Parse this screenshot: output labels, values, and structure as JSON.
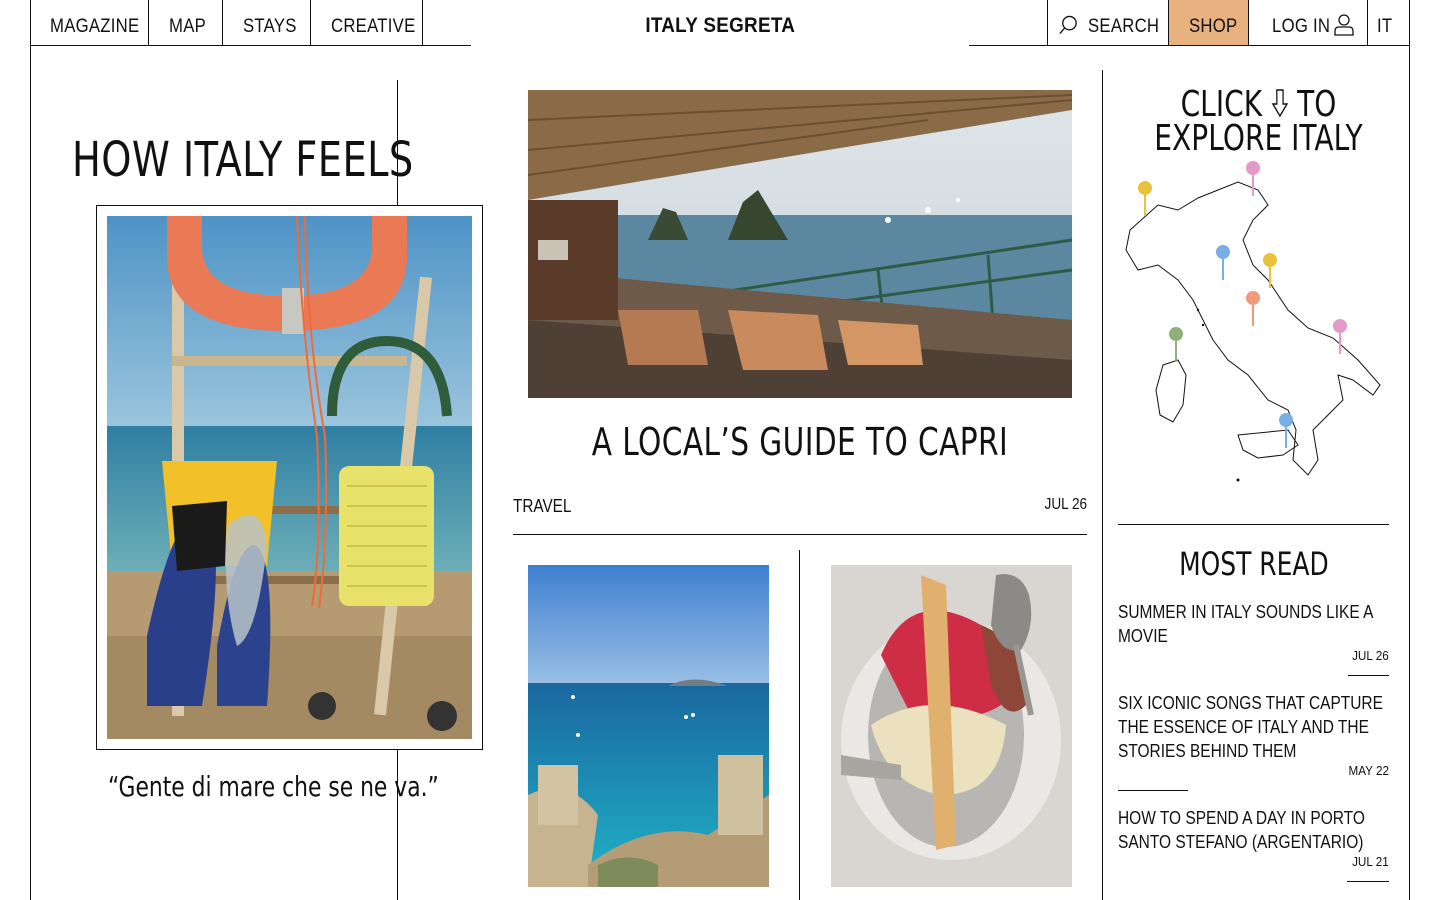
{
  "nav": {
    "left": [
      "Magazine",
      "Map",
      "Stays",
      "Creative"
    ],
    "brand": "ITALY SEGRETA",
    "search_label": "SEARCH",
    "shop_label": "SHOP",
    "login_label": "LOG IN",
    "lang_label": "IT"
  },
  "colors": {
    "shop_bg": "#e7b280",
    "ink": "#111111",
    "background": "#ffffff"
  },
  "feature": {
    "title": "HOW ITALY FEELS",
    "quote": "“Gente di mare che se ne va.”"
  },
  "center": {
    "title": "A LOCAL’S GUIDE TO CAPRI",
    "category": "TRAVEL",
    "date": "JUL 26"
  },
  "explore": {
    "line1": "CLICK",
    "line1b": "TO",
    "line2": "EXPLORE ITALY",
    "pin_colors": [
      "#e8c23a",
      "#e39ac9",
      "#7aaee6",
      "#e8c23a",
      "#ee9b7a",
      "#8fb07a",
      "#e39ac9",
      "#7aaee6"
    ]
  },
  "most_read": {
    "heading": "MOST READ",
    "items": [
      {
        "title": "SUMMER IN ITALY SOUNDS LIKE A MOVIE",
        "date": "JUL 26"
      },
      {
        "title": "SIX ICONIC SONGS THAT CAPTURE THE ESSENCE OF ITALY AND THE STORIES BEHIND THEM",
        "date": "MAY 22"
      },
      {
        "title": "HOW TO SPEND A DAY IN PORTO SANTO STEFANO (ARGENTARIO)",
        "date": "JUL 21"
      }
    ]
  }
}
